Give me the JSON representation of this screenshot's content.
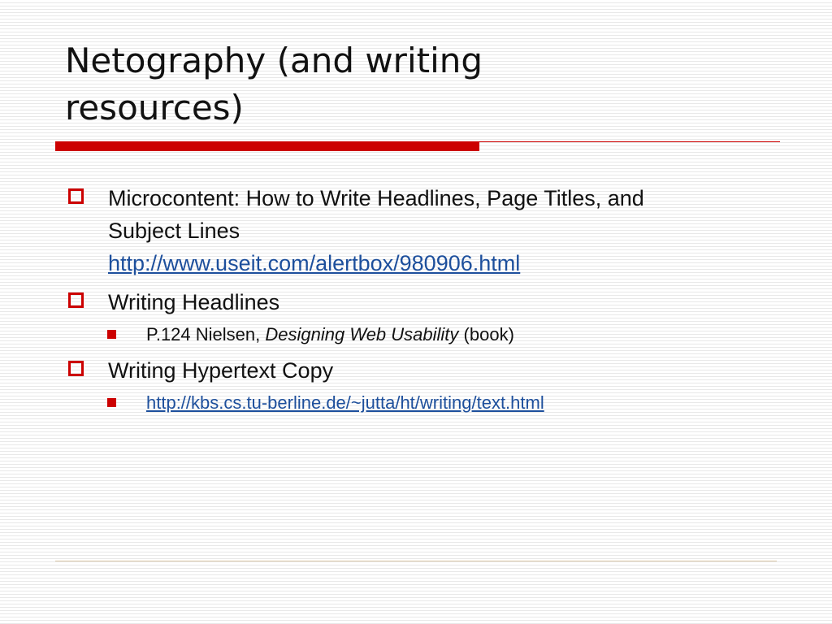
{
  "slide": {
    "title": "Netography (and writing resources)",
    "bullets": [
      {
        "text": "Microcontent: How to Write Headlines, Page Titles, and Subject Lines",
        "link": "http://www.useit.com/alertbox/980906.html"
      },
      {
        "text": "Writing Headlines",
        "sub": [
          {
            "prefix": "P.124 Nielsen, ",
            "italic": "Designing Web Usability",
            "suffix": " (book)"
          }
        ]
      },
      {
        "text": "Writing Hypertext Copy",
        "sub": [
          {
            "link": "http://kbs.cs.tu-berline.de/~jutta/ht/writing/text.html"
          }
        ]
      }
    ]
  },
  "colors": {
    "accent": "#cc0000",
    "link": "#1d4f9c",
    "text": "#111111"
  },
  "icons": {
    "level1_bullet": "hollow-square-icon",
    "level2_bullet": "filled-square-icon"
  }
}
